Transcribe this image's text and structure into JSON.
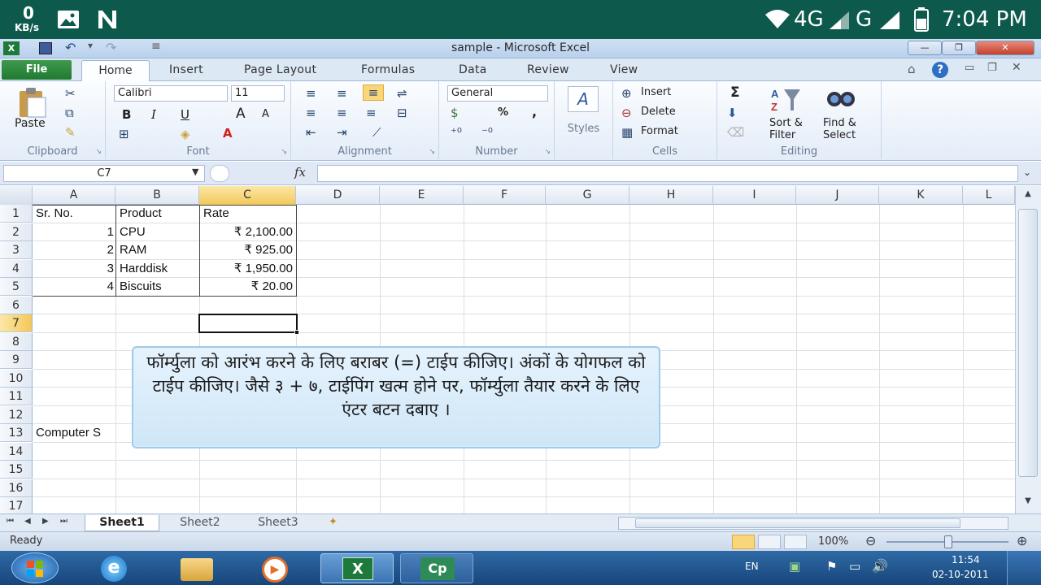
{
  "status_bar": {
    "speed_value": "0",
    "speed_unit": "KB/s",
    "network_4g": "4G",
    "network_g": "G",
    "time": "7:04 PM"
  },
  "window": {
    "title": "sample - Microsoft Excel"
  },
  "tabs": [
    "File",
    "Home",
    "Insert",
    "Page Layout",
    "Formulas",
    "Data",
    "Review",
    "View"
  ],
  "ribbon": {
    "clipboard": {
      "paste": "Paste",
      "label": "Clipboard"
    },
    "font": {
      "family": "Calibri",
      "size": "11",
      "bold": "B",
      "italic": "I",
      "underline": "U",
      "grow": "A",
      "shrink": "A",
      "label": "Font"
    },
    "alignment": {
      "label": "Alignment"
    },
    "number": {
      "format": "General",
      "percent": "%",
      "comma": ",",
      "label": "Number"
    },
    "styles": {
      "label": "Styles"
    },
    "cells": {
      "insert": "Insert",
      "delete": "Delete",
      "format": "Format",
      "label": "Cells"
    },
    "editing": {
      "sigma": "Σ",
      "sort_line1": "Sort &",
      "sort_line2": "Filter",
      "find_line1": "Find &",
      "find_line2": "Select",
      "label": "Editing"
    }
  },
  "formula_bar": {
    "name_box": "C7",
    "fx": "fx",
    "formula": ""
  },
  "grid": {
    "columns": [
      "A",
      "B",
      "C",
      "D",
      "E",
      "F",
      "G",
      "H",
      "I",
      "J",
      "K",
      "L"
    ],
    "rows": [
      "1",
      "2",
      "3",
      "4",
      "5",
      "6",
      "7",
      "8",
      "9",
      "10",
      "11",
      "12",
      "13",
      "14",
      "15",
      "16",
      "17"
    ],
    "cells": {
      "a1": "Sr. No.",
      "b1": "Product",
      "c1": "Rate",
      "a2": "1",
      "b2": "CPU",
      "c2": "₹  2,100.00",
      "a3": "2",
      "b3": "RAM",
      "c3": "₹  925.00",
      "a4": "3",
      "b4": "Harddisk",
      "c4": "₹  1,950.00",
      "a5": "4",
      "b5": "Biscuits",
      "c5": "₹  20.00",
      "a13": "Computer S"
    },
    "selected_cell": "C7"
  },
  "callout": {
    "text": "फॉर्म्युला को आरंभ करने के लिए बराबर (=) टाईप कीजिए। अंकों के योगफल को टाईप कीजिए। जैसे ३ + ७, टाईपिंग खत्म होने पर, फॉर्म्युला तैयार करने के लिए एंटर बटन दबाए ।"
  },
  "sheets": [
    "Sheet1",
    "Sheet2",
    "Sheet3"
  ],
  "status": {
    "ready": "Ready",
    "zoom": "100%"
  },
  "taskbar": {
    "lang": "EN",
    "clock_time": "11:54",
    "clock_date": "02-10-2011",
    "cp_label": "Cp"
  },
  "colors": {
    "status_bar": "#0d5a4d",
    "file_tab": "#1f7a32",
    "taskbar": "#1e5490",
    "selected_col": "#f8d77b",
    "callout_bg": "#dcefff"
  }
}
